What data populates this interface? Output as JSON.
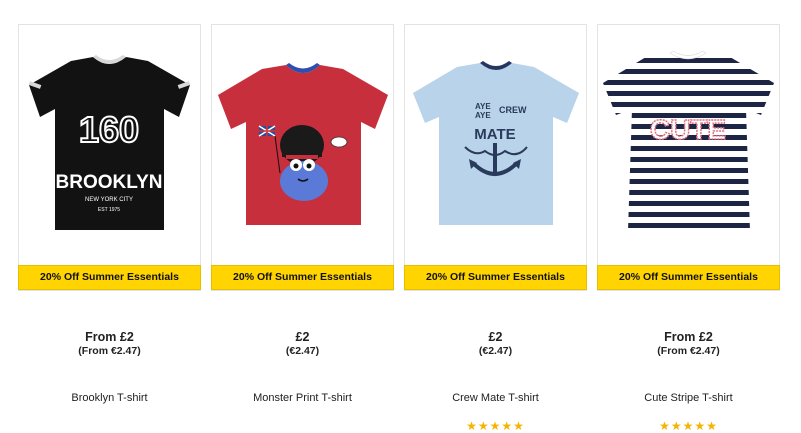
{
  "products": [
    {
      "name": "Brooklyn T-shirt",
      "promo": "20% Off Summer Essentials",
      "price": "From £2",
      "price_eur": "(From €2.47)",
      "rating_stars": 0,
      "print_top": "160",
      "print_main": "BROOKLYN",
      "print_sub": "NEW YORK CITY",
      "print_tag": "EST 1975",
      "colors": {
        "shirt": "#121212",
        "collar": "#d8d8d8",
        "print": "#ffffff"
      }
    },
    {
      "name": "Monster Print T-shirt",
      "promo": "20% Off Summer Essentials",
      "price": "£2",
      "price_eur": "(€2.47)",
      "rating_stars": 0,
      "colors": {
        "shirt": "#c62f3b",
        "collar": "#2f4fb0",
        "monster": "#5b7ad8",
        "hat": "#1a1a1a"
      }
    },
    {
      "name": "Crew Mate T-shirt",
      "promo": "20% Off Summer Essentials",
      "price": "£2",
      "price_eur": "(€2.47)",
      "rating_stars": 5,
      "print_line1": "AYE",
      "print_line2": "AYE",
      "print_crew": "CREW",
      "print_mate": "MATE",
      "colors": {
        "shirt": "#b8d3ea",
        "collar": "#243661",
        "print": "#2a3a5a"
      }
    },
    {
      "name": "Cute Stripe T-shirt",
      "promo": "20% Off Summer Essentials",
      "price": "From £2",
      "price_eur": "(From €2.47)",
      "rating_stars": 5,
      "print_word": "CUTE",
      "colors": {
        "shirt": "#ffffff",
        "stripe": "#1c2544",
        "print": "#e0707f"
      }
    }
  ]
}
